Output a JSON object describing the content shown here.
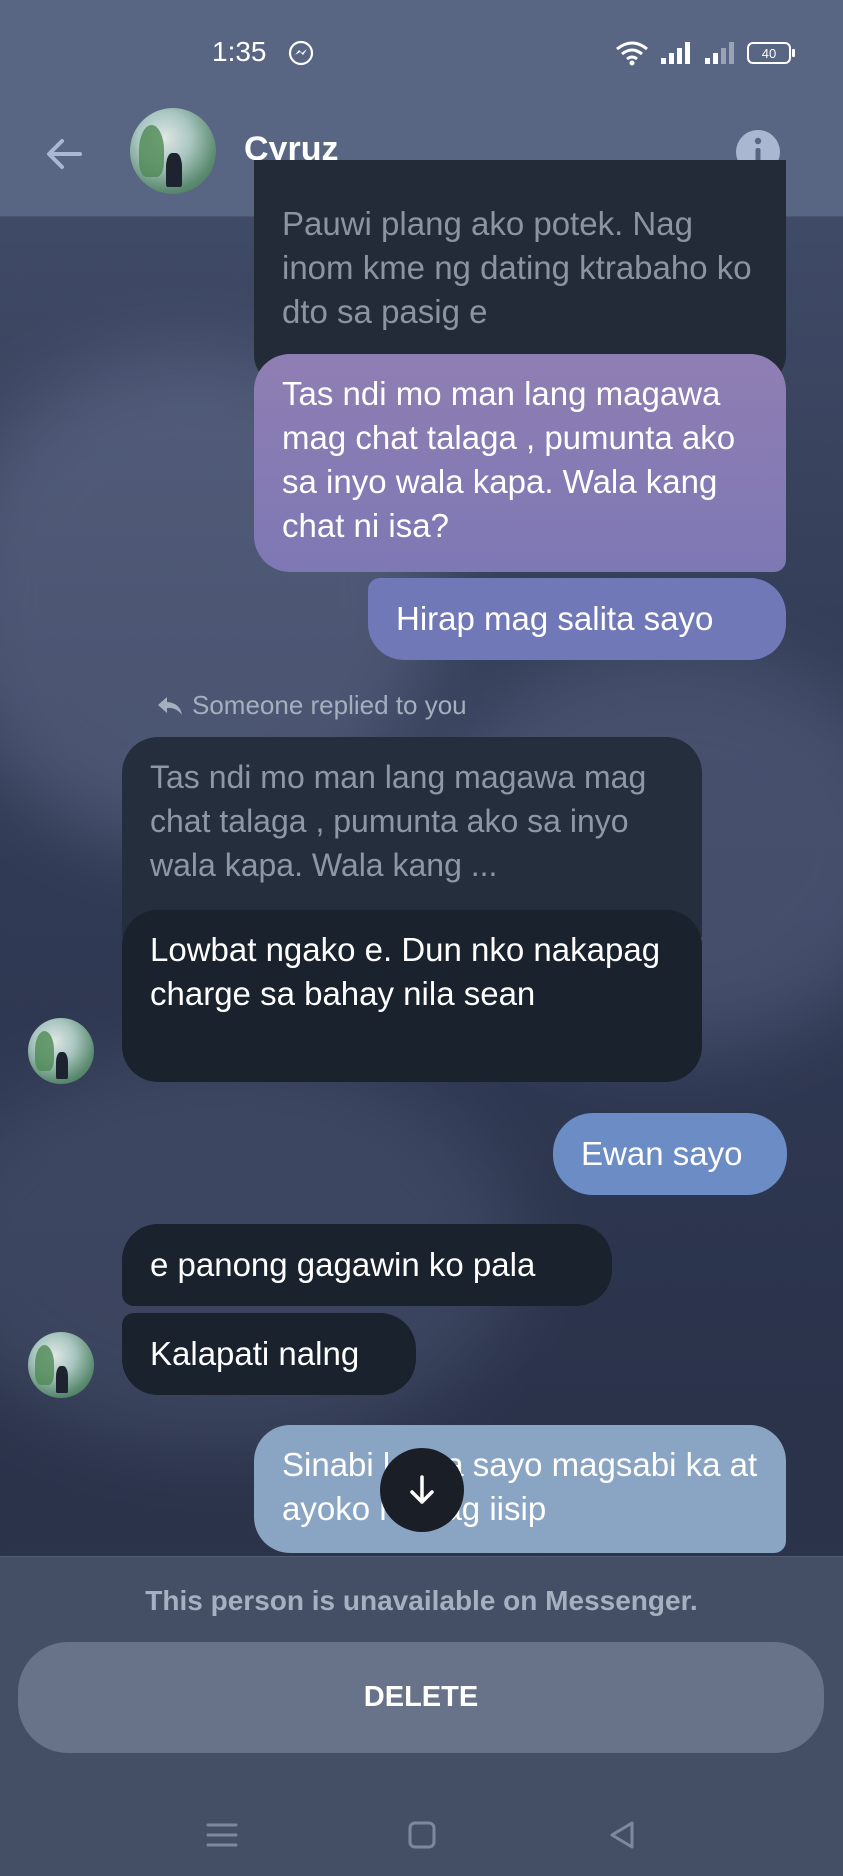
{
  "status_bar": {
    "time": "1:35",
    "battery": "40"
  },
  "header": {
    "contact_name": "Cyruz"
  },
  "messages": {
    "m1": "Pauwi plang ako potek. Nag inom kme ng dating ktrabaho ko dto sa pasig e",
    "m2": "Tas ndi mo man lang magawa mag chat talaga , pumunta ako sa inyo wala kapa. Wala kang chat ni isa?",
    "m3": "Hirap mag salita sayo",
    "reply_label": "Someone replied to you",
    "quoted": "Tas ndi mo man lang magawa mag chat talaga , pumunta ako sa inyo wala kapa. Wala kang ...",
    "m4": "Lowbat ngako e. Dun nko nakapag charge sa bahay nila sean",
    "m5": "Ewan sayo",
    "m6": "e panong gagawin ko pala",
    "m7": "Kalapati nalng",
    "m8": "Sinabi ko na sayo magsabi ka at ayoko ng nag iisip"
  },
  "footer": {
    "unavailable_text": "This person is unavailable on Messenger.",
    "delete_label": "DELETE"
  },
  "colors": {
    "purple_bubble": "#8b7bb0",
    "blue_bubble": "#6a86c2",
    "light_blue_bubble": "#8eabc7",
    "dark_bubble": "#1a222e"
  }
}
